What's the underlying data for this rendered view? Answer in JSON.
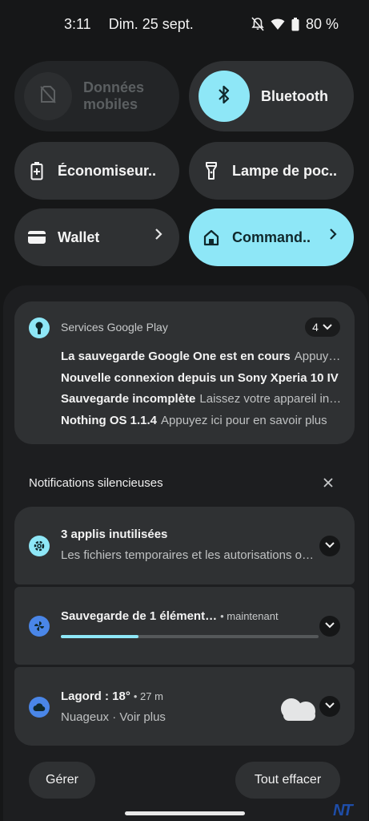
{
  "status_bar": {
    "time": "3:11",
    "date": "Dim. 25 sept.",
    "battery": "80 %"
  },
  "quick_tiles": [
    {
      "id": "mobile-data",
      "label_line1": "Données",
      "label_line2": "mobiles",
      "state": "disabled",
      "icon": "no-sim-icon"
    },
    {
      "id": "bluetooth",
      "label": "Bluetooth",
      "state": "on",
      "icon": "bluetooth-icon"
    },
    {
      "id": "battery-saver",
      "label": "Économiseur..",
      "state": "off",
      "icon": "battery-saver-icon"
    },
    {
      "id": "flashlight",
      "label": "Lampe de poc..",
      "state": "off",
      "icon": "flashlight-icon"
    },
    {
      "id": "wallet",
      "label": "Wallet",
      "state": "off",
      "icon": "wallet-icon"
    },
    {
      "id": "home-controls",
      "label": "Command..",
      "state": "on",
      "icon": "home-icon"
    }
  ],
  "google_play_notification": {
    "app": "Services Google Play",
    "count": "4",
    "lines": [
      {
        "title": "La sauvegarde Google One est en cours",
        "text": "Appuyez ici pour en savoir plus"
      },
      {
        "title": "Nouvelle connexion depuis un Sony Xperia 10 IV",
        "text": ""
      },
      {
        "title": "Sauvegarde incomplète",
        "text": "Laissez votre appareil inactif"
      },
      {
        "title": "Nothing OS 1.1.4",
        "text": "Appuyez ici pour en savoir plus"
      }
    ]
  },
  "silent_section": {
    "header": "Notifications silencieuses",
    "items": [
      {
        "title": "3 applis inutilisées",
        "meta": "",
        "text": "Les fichiers temporaires et les autorisations ont été supprimés"
      },
      {
        "title": "Sauvegarde de 1 élément…",
        "meta": "• maintenant",
        "progress": 0.3
      },
      {
        "title": "Lagord : 18°",
        "meta": "• 27 m",
        "text": "Nuageux · Voir plus"
      }
    ]
  },
  "footer": {
    "manage_label": "Gérer",
    "clear_all_label": "Tout effacer"
  },
  "watermark": "NT",
  "colors": {
    "accent": "#8ee7f7",
    "tile": "#2f3133",
    "background": "#161718",
    "weather_icon": "#4a86e8"
  }
}
